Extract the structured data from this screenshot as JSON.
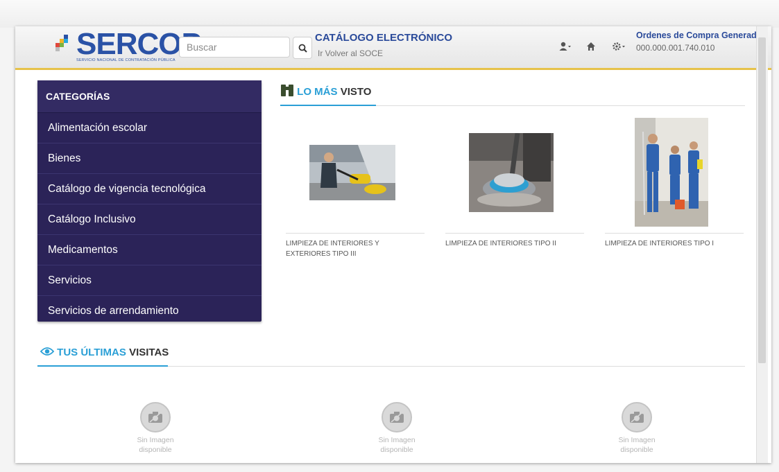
{
  "header": {
    "logo_text": "SERCOP",
    "logo_subtext": "SERVICIO NACIONAL DE CONTRATACIÓN PÚBLICA",
    "search_placeholder": "Buscar",
    "catalog_title": "CATÁLOGO ELECTRÓNICO",
    "back_link": "Ir Volver al SOCE",
    "orders_title": "Ordenes de Compra Generadas",
    "orders_count": "000.000.001.740.010",
    "icons": [
      "user-icon",
      "home-icon",
      "gear-icon"
    ]
  },
  "sidebar": {
    "title": "CATEGORÍAS",
    "items": [
      {
        "label": "Alimentación escolar"
      },
      {
        "label": "Bienes"
      },
      {
        "label": "Catálogo de vigencia tecnológica"
      },
      {
        "label": "Catálogo Inclusivo"
      },
      {
        "label": "Medicamentos"
      },
      {
        "label": "Servicios"
      },
      {
        "label": "Servicios de arrendamiento"
      }
    ]
  },
  "most_viewed": {
    "title_accent": "LO MÁS",
    "title_rest": "VISTO",
    "products": [
      {
        "name": "LIMPIEZA DE INTERIORES Y EXTERIORES TIPO III"
      },
      {
        "name": "LIMPIEZA DE INTERIORES TIPO II"
      },
      {
        "name": "LIMPIEZA DE INTERIORES TIPO I"
      }
    ]
  },
  "recent": {
    "title_accent": "TUS ÚLTIMAS",
    "title_rest": "VISITAS",
    "placeholders": [
      {
        "line1": "Sin Imagen",
        "line2": "disponible"
      },
      {
        "line1": "Sin Imagen",
        "line2": "disponible"
      },
      {
        "line1": "Sin Imagen",
        "line2": "disponible"
      }
    ]
  },
  "colors": {
    "brand_blue": "#2a52a6",
    "sidebar_bg": "#2b2358",
    "accent": "#2a9fd6",
    "header_border": "#e6c24a"
  }
}
